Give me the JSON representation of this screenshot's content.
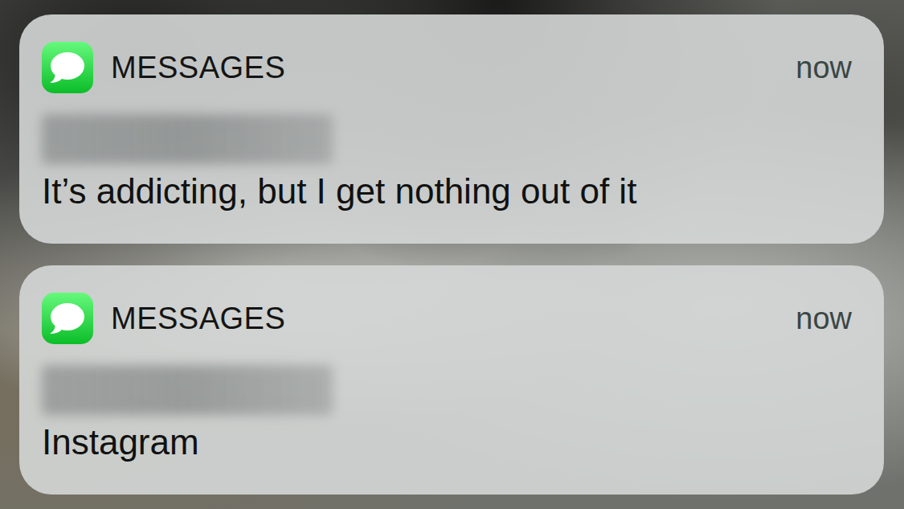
{
  "screen": {
    "kind": "lock-screen-notifications"
  },
  "notifications": [
    {
      "app": "MESSAGES",
      "time": "now",
      "sender": {
        "blurred": true
      },
      "body": "It’s addicting, but I get nothing out of it"
    },
    {
      "app": "MESSAGES",
      "time": "now",
      "sender": {
        "blurred": true
      },
      "body": "Instagram"
    }
  ]
}
